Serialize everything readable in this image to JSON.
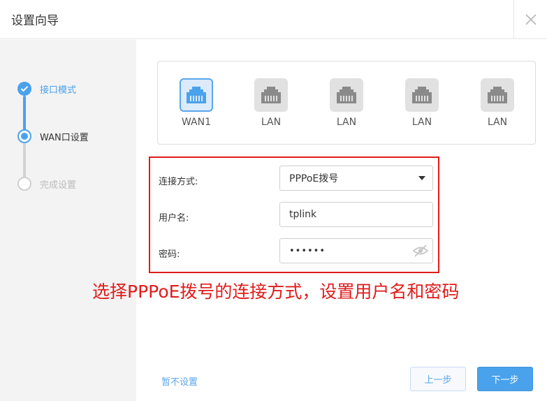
{
  "header": {
    "title": "设置向导"
  },
  "steps": [
    {
      "label": "接口模式",
      "state": "done"
    },
    {
      "label": "WAN口设置",
      "state": "current"
    },
    {
      "label": "完成设置",
      "state": "pending"
    }
  ],
  "ports": [
    {
      "label": "WAN1",
      "active": true
    },
    {
      "label": "LAN",
      "active": false
    },
    {
      "label": "LAN",
      "active": false
    },
    {
      "label": "LAN",
      "active": false
    },
    {
      "label": "LAN",
      "active": false
    }
  ],
  "form": {
    "connection_label": "连接方式:",
    "connection_value": "PPPoE拨号",
    "username_label": "用户名:",
    "username_value": "tplink",
    "password_label": "密码:",
    "password_value": "••••••"
  },
  "annotation": "选择PPPoE拨号的连接方式，设置用户名和密码",
  "footer": {
    "skip_label": "暂不设置",
    "prev_label": "上一步",
    "next_label": "下一步"
  },
  "colors": {
    "accent": "#4aa2ec",
    "annotation_red": "#e01b1b",
    "step_pending": "#cfcfcf"
  }
}
